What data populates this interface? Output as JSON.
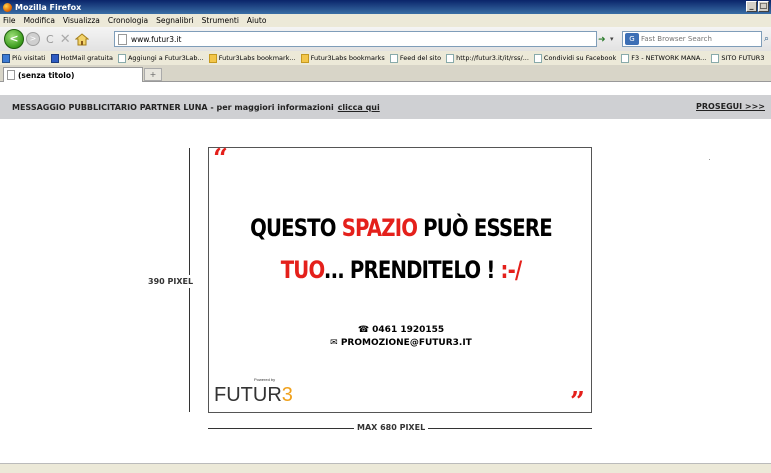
{
  "window": {
    "title": "Mozilla Firefox",
    "min": "_",
    "max": "□"
  },
  "menu": [
    "File",
    "Modifica",
    "Visualizza",
    "Cronologia",
    "Segnalibri",
    "Strumenti",
    "Aiuto"
  ],
  "nav": {
    "url": "www.futur3.it",
    "search_placeholder": "Fast Browser Search",
    "back": "<",
    "fwd": ">",
    "stop": "✕",
    "reload": "C",
    "go": "➜",
    "dropdown": "▾"
  },
  "bookmarks": [
    {
      "label": "Più visitati",
      "icon": "star-icon"
    },
    {
      "label": "HotMail gratuita",
      "icon": "hotmail-icon"
    },
    {
      "label": "Aggiungi a Futur3Lab...",
      "icon": "page-icon"
    },
    {
      "label": "Futur3Labs bookmark...",
      "icon": "folder-icon"
    },
    {
      "label": "Futur3Labs bookmarks",
      "icon": "folder-icon"
    },
    {
      "label": "Feed del sito",
      "icon": "page-icon"
    },
    {
      "label": "http://futur3.it/it/rss/...",
      "icon": "page-icon"
    },
    {
      "label": "Condividi su Facebook",
      "icon": "page-icon"
    },
    {
      "label": "F3 - NETWORK MANA...",
      "icon": "page-icon"
    },
    {
      "label": "SITO FUTUR3",
      "icon": "page-icon"
    }
  ],
  "tab": {
    "title": "(senza titolo)",
    "new": "+"
  },
  "promo": {
    "text": "MESSAGGIO PUBBLICITARIO PARTNER LUNA  -  per maggiori informazioni",
    "link": "clicca qui",
    "continue": "PROSEGUI >>>"
  },
  "ad": {
    "quote_open": "“",
    "quote_close": "”",
    "line1_a": "QUESTO ",
    "line1_b": "SPAZIO",
    "line1_c": " PUÒ ESSERE",
    "line2_a": "TUO",
    "line2_b": "... PRENDITELO ! ",
    "line2_c": ":-/",
    "phone": "☎ 0461 1920155",
    "email": "✉ PROMOZIONE@FUTUR3.IT",
    "logo_powered": "Powered by",
    "logo_a": "FUTUR",
    "logo_b": "3"
  },
  "dims": {
    "height_label": "390 PIXEL",
    "width_label": "MAX 680 PIXEL"
  },
  "colors": {
    "accent": "#e4201b",
    "logo_accent": "#f0a11c"
  }
}
